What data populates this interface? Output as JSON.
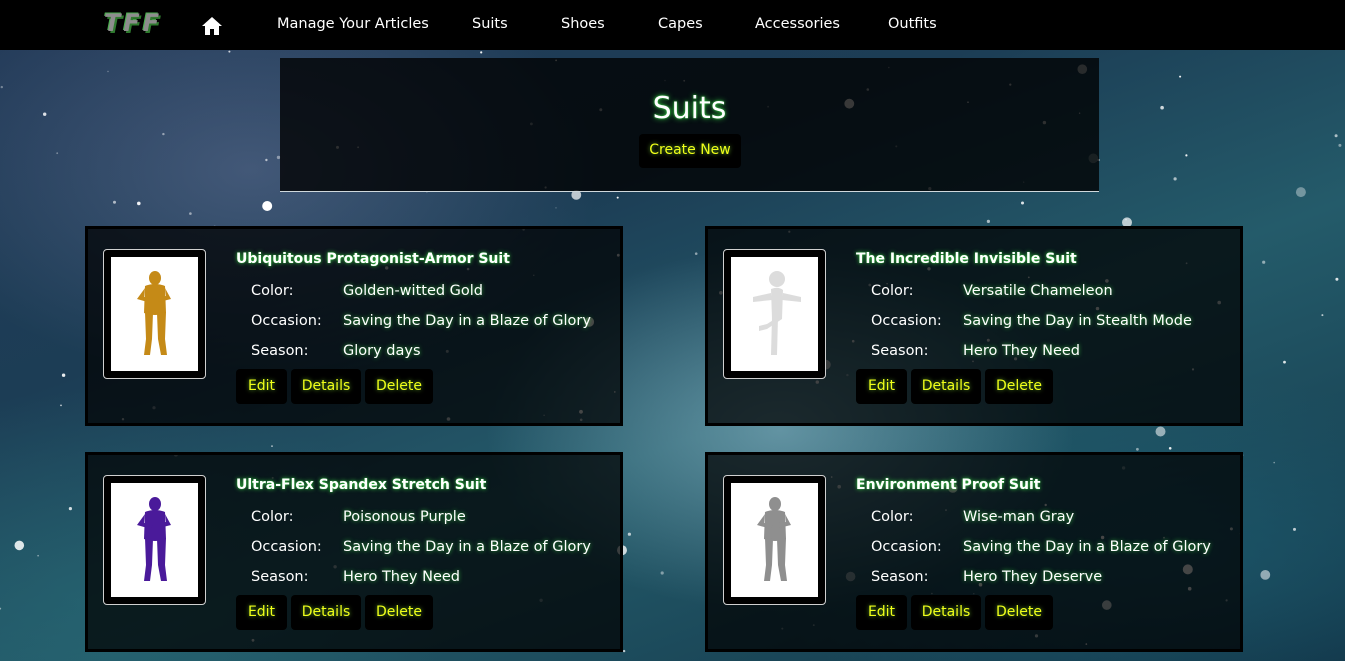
{
  "navbar": {
    "brand": "TFF",
    "home_icon": "home-icon",
    "links": [
      "Manage Your Articles",
      "Suits",
      "Shoes",
      "Capes",
      "Accessories",
      "Outfits"
    ]
  },
  "header": {
    "title": "Suits",
    "create_label": "Create New"
  },
  "labels": {
    "color": "Color:",
    "occasion": "Occasion:",
    "season": "Season:",
    "edit": "Edit",
    "details": "Details",
    "delete": "Delete"
  },
  "suits": [
    {
      "name": "Ubiquitous Protagonist-Armor Suit",
      "color": "Golden-witted Gold",
      "occasion": "Saving the Day in a Blaze of Glory",
      "season": "Glory days",
      "figure_color": "#c58a17"
    },
    {
      "name": "The Incredible Invisible Suit",
      "color": "Versatile Chameleon",
      "occasion": "Saving the Day in Stealth Mode",
      "season": "Hero They Need",
      "figure_color": "#dcdcdc"
    },
    {
      "name": "Ultra-Flex Spandex Stretch Suit",
      "color": "Poisonous Purple",
      "occasion": "Saving the Day in a Blaze of Glory",
      "season": "Hero They Need",
      "figure_color": "#4a1a9a"
    },
    {
      "name": "Environment Proof Suit",
      "color": "Wise-man Gray",
      "occasion": "Saving the Day in a Blaze of Glory",
      "season": "Hero They Deserve",
      "figure_color": "#8f8f8f"
    }
  ],
  "theme": {
    "accent_text": "#f0ff1a",
    "glow": "#2ecc40",
    "panel": "#000000"
  }
}
